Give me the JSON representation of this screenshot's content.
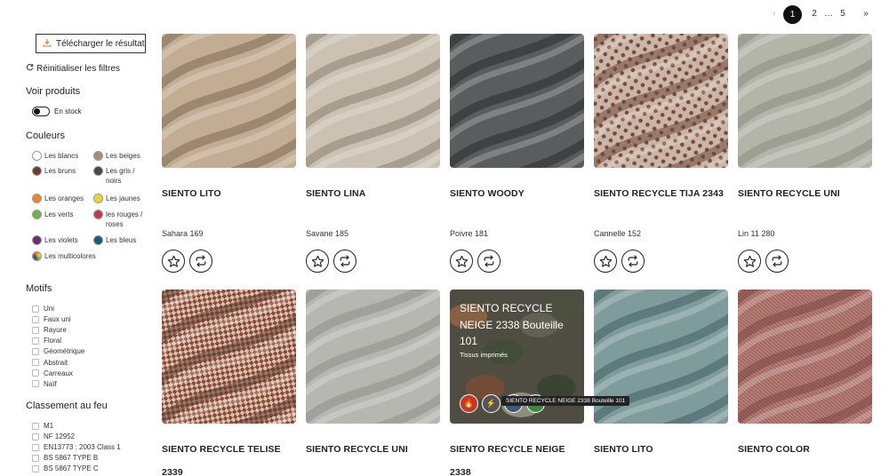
{
  "pagination": {
    "prev": "‹",
    "pages": [
      "1",
      "2",
      "…",
      "5"
    ],
    "next": "»"
  },
  "sidebar": {
    "download_label": "Télécharger le résultat",
    "reset_label": "Réinitialiser les filtres",
    "voir_title": "Voir produits",
    "stock_label": "En stock",
    "colors_title": "Couleurs",
    "colors": [
      {
        "label": "Les blancs",
        "color": "#ffffff"
      },
      {
        "label": "Les beiges",
        "color": "#b08a73"
      },
      {
        "label": "Les bruns",
        "color": "#6b3e2e"
      },
      {
        "label": "Les gris / noirs",
        "color": "#4a4a4a"
      },
      {
        "label": "Les oranges",
        "color": "#e8852f"
      },
      {
        "label": "Les jaunes",
        "color": "#f4d236"
      },
      {
        "label": "Les verts",
        "color": "#6cb24a"
      },
      {
        "label": "les rouges / roses",
        "color": "#c73650"
      },
      {
        "label": "Les violets",
        "color": "#6a2e6e"
      },
      {
        "label": "Les bleus",
        "color": "#1d5a78"
      },
      {
        "label": "Les multicolores",
        "color": "#8fbf4e"
      }
    ],
    "motifs_title": "Motifs",
    "motifs": [
      "Uni",
      "Faux uni",
      "Rayure",
      "Floral",
      "Géométrique",
      "Abstrait",
      "Carreaux",
      "Naïf"
    ],
    "feu_title": "Classement au feu",
    "feu": [
      "M1",
      "NF 12952",
      "EN13773 : 2003 Class 1",
      "BS 5867 TYPE B",
      "BS 5867 TYPE C"
    ]
  },
  "products": [
    {
      "name": "SIENTO LITO",
      "variant": "Sahara 169",
      "base": "#c2ad92",
      "dark": "#7e6a52"
    },
    {
      "name": "SIENTO LINA",
      "variant": "Savane 185",
      "base": "#cbc2b3",
      "dark": "#8b8172"
    },
    {
      "name": "SIENTO WOODY",
      "variant": "Poivre 181",
      "base": "#5a5d5e",
      "dark": "#2a2c2d"
    },
    {
      "name": "SIENTO RECYCLE TIJA 2343",
      "variant": "Cannelle 152",
      "base": "#b79684",
      "dark": "#6e4838"
    },
    {
      "name": "SIENTO RECYCLE UNI",
      "variant": "Lin 11 280",
      "base": "#b3b5a9",
      "dark": "#8a8c80"
    },
    {
      "name": "SIENTO RECYCLE TELISE 2339",
      "variant": "",
      "base": "#a57766",
      "dark": "#5d3a2e"
    },
    {
      "name": "SIENTO RECYCLE UNI",
      "variant": "",
      "base": "#b6b7b1",
      "dark": "#8f908a"
    },
    {
      "name": "SIENTO RECYCLE NEIGE 2338",
      "variant": "",
      "base": "#6e6a5a",
      "dark": "#3a3a2e"
    },
    {
      "name": "SIENTO LITO",
      "variant": "",
      "base": "#7f9c9d",
      "dark": "#415e60"
    },
    {
      "name": "SIENTO COLOR",
      "variant": "",
      "base": "#b67e76",
      "dark": "#7c4943"
    }
  ],
  "hover_card": {
    "title": "SIENTO RECYCLE NEIGE 2338 Bouteille 101",
    "subtitle": "Tissus imprimés",
    "tooltip": "SIENTO RECYCLE NEIGE 2338 Bouteille 101"
  }
}
